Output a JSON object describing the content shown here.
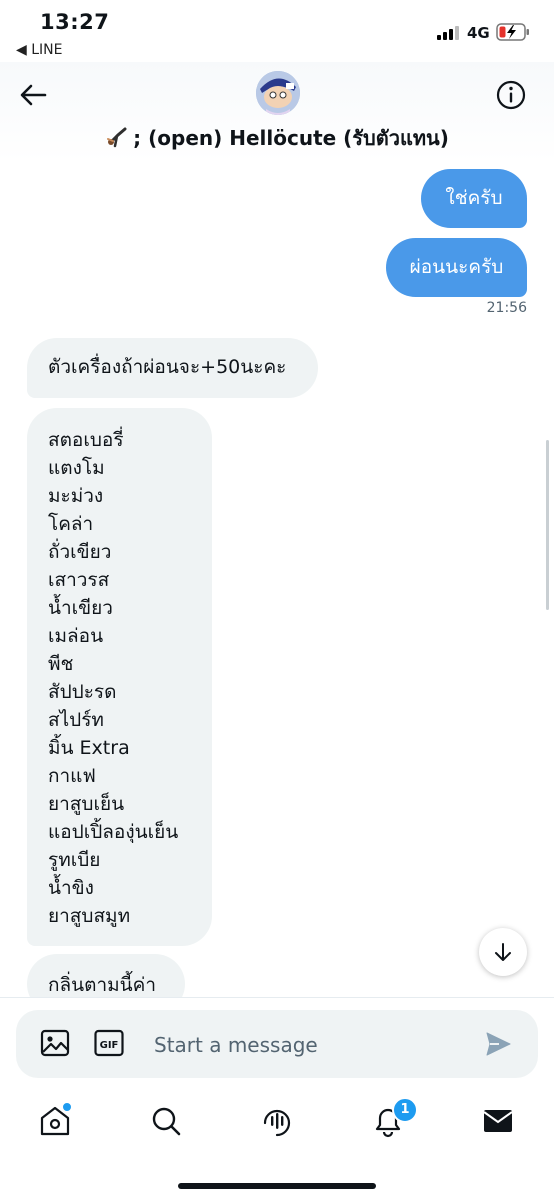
{
  "status_bar": {
    "time": "13:27",
    "back_app": "◀ LINE",
    "network": "4G"
  },
  "header": {
    "title": "; (open) Hellöcute (รับตัวแทน)"
  },
  "messages": {
    "outgoing": [
      {
        "text": "ใช่ครับ"
      },
      {
        "text": "ผ่อนนะครับ"
      }
    ],
    "outgoing_time": "21:56",
    "incoming_1": "ตัวเครื่องถ้าผ่อนจะ+50นะคะ",
    "flavors": [
      "สตอเบอรี่",
      "แตงโม",
      "มะม่วง",
      "โคล่า",
      "ถั่วเขียว",
      "เสาวรส",
      "น้ำเขียว",
      "เมล่อน",
      "พีช",
      "สัปปะรด",
      "สไปร์ท",
      "มิ้น Extra",
      "กาแฟ",
      "ยาสูบเย็น",
      "แอปเปิ้ลองุ่นเย็น",
      "รูทเบีย",
      "น้ำขิง",
      "ยาสูบสมูท"
    ],
    "incoming_3": "กลิ่นตามนี้ค่า"
  },
  "composer": {
    "placeholder": "Start a message"
  },
  "tabbar": {
    "notification_count": "1"
  },
  "colors": {
    "accent": "#1d9bf0",
    "outgoing_bubble": "#4a99e9",
    "incoming_bubble": "#eff3f4"
  },
  "icons": [
    "back-arrow-icon",
    "info-icon",
    "image-icon",
    "gif-icon",
    "send-icon",
    "home-icon",
    "search-icon",
    "spaces-icon",
    "bell-icon",
    "mail-icon",
    "arrow-down-icon"
  ]
}
